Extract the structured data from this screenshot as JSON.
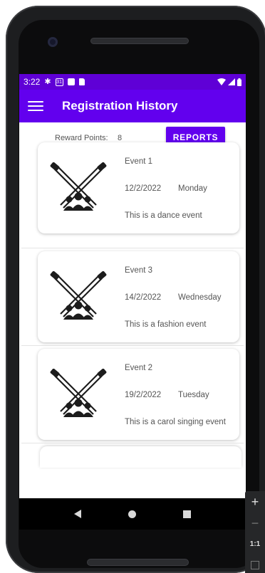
{
  "status_bar": {
    "time": "3:22",
    "left_icons": [
      "gear-icon",
      "calendar-icon",
      "app-icon",
      "sim-icon"
    ],
    "calendar_day": "31",
    "right_icons": [
      "wifi-icon",
      "cell-signal-icon",
      "battery-icon"
    ]
  },
  "app_bar": {
    "title": "Registration History",
    "menu_icon": "hamburger-menu-icon"
  },
  "reward": {
    "label": "Reward Points:",
    "value": "8"
  },
  "reports_button": {
    "label": "REPORTS"
  },
  "events": [
    {
      "name": "Event 1",
      "date": "12/2/2022",
      "day": "Monday",
      "description": "This is a dance event",
      "icon": "spotlight-audience-icon"
    },
    {
      "name": "Event 3",
      "date": "14/2/2022",
      "day": "Wednesday",
      "description": "This is a fashion event",
      "icon": "spotlight-audience-icon"
    },
    {
      "name": "Event 2",
      "date": "19/2/2022",
      "day": "Tuesday",
      "description": "This is a carol singing event",
      "icon": "spotlight-audience-icon"
    }
  ],
  "nav_bar": {
    "icons": [
      "back-icon",
      "home-icon",
      "recent-apps-icon"
    ]
  },
  "zoom_controls": {
    "zoom_in": "+",
    "zoom_out": "−",
    "ratio": "1:1",
    "fit_icon": "fit-screen-icon"
  },
  "colors": {
    "primary": "#6200ee",
    "status_bar": "#5f00d6",
    "text_secondary": "#555555"
  }
}
